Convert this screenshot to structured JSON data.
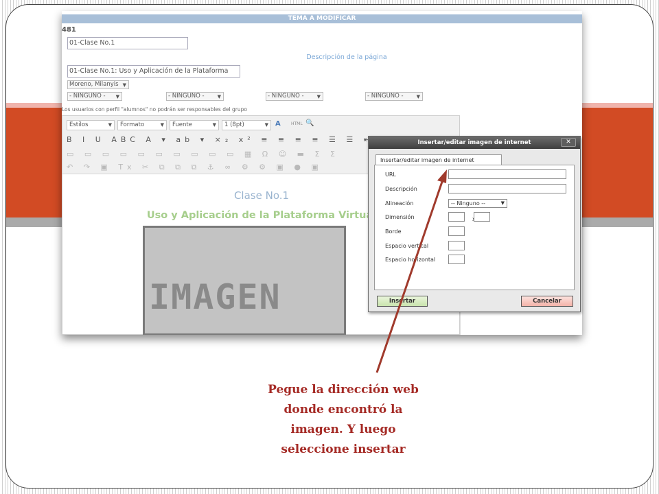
{
  "theme": {
    "band_color": "#d24b24",
    "caption_color": "#a52a25",
    "arrow_color": "#a03a2c",
    "dialog_title_color": "#4a4a4a"
  },
  "editor_page": {
    "header_title": "TEMA A MODIFICAR",
    "record_id": "481",
    "title_field_value": "01-Clase No.1",
    "description_heading": "Descripción de la página",
    "description_field_value": "01-Clase No.1: Uso y Aplicación de la Plataforma",
    "author_select_value": "Moreno, Milanyis",
    "responsible_selects": [
      "- NINGUNO -",
      "- NINGUNO -",
      "- NINGUNO -",
      "- NINGUNO -"
    ],
    "responsible_note": "Los usuarios con perfil \"alumnos\" no podrán ser responsables del grupo"
  },
  "toolbar": {
    "styles_combo": "Estilos",
    "format_combo": "Formato",
    "font_combo": "Fuente",
    "size_combo": "1 (8pt)",
    "html_label": "HTML",
    "row1_icons": "B I U ABC A ▾ ab ▾ ×₂ x² ≡ ≡ ≡ ≡ ☰ ☰ ⇤ ⇥",
    "row2_icons": "▭ ▭ ▭ ▭ ▭ ▭ ▭ ▭ ▭ ▭ ▦ Ω ☺ ▬ Σ Σ",
    "row3_icons": "↶ ↷ ▣ Tx ✂ ⧉ ⧉ ⧉ ⚓ ∞ ⚙ ⚙ ▣ ● ▣"
  },
  "editor_content": {
    "title": "Clase No.1",
    "subtitle": "Uso y Aplicación de la Plataforma Virtual",
    "image_placeholder_text": "IMAGEN"
  },
  "dialog": {
    "title": "Insertar/editar imagen de internet",
    "close_label": "✕",
    "tab_label": "Insertar/editar imagen de internet",
    "fields": {
      "url_label": "URL",
      "url_value": "",
      "description_label": "Descripción",
      "description_value": "",
      "alignment_label": "Alineación",
      "alignment_value": "-- Ninguno --",
      "dimension_label": "Dimensión",
      "dimension_separator": "x",
      "border_label": "Borde",
      "vspace_label": "Espacio vertical",
      "hspace_label": "Espacio horizontal"
    },
    "insert_button": "Insertar",
    "cancel_button": "Cancelar"
  },
  "caption": {
    "line1": "Pegue la dirección web",
    "line2": "donde encontró la",
    "line3": "imagen. Y luego",
    "line4": "seleccione insertar"
  }
}
